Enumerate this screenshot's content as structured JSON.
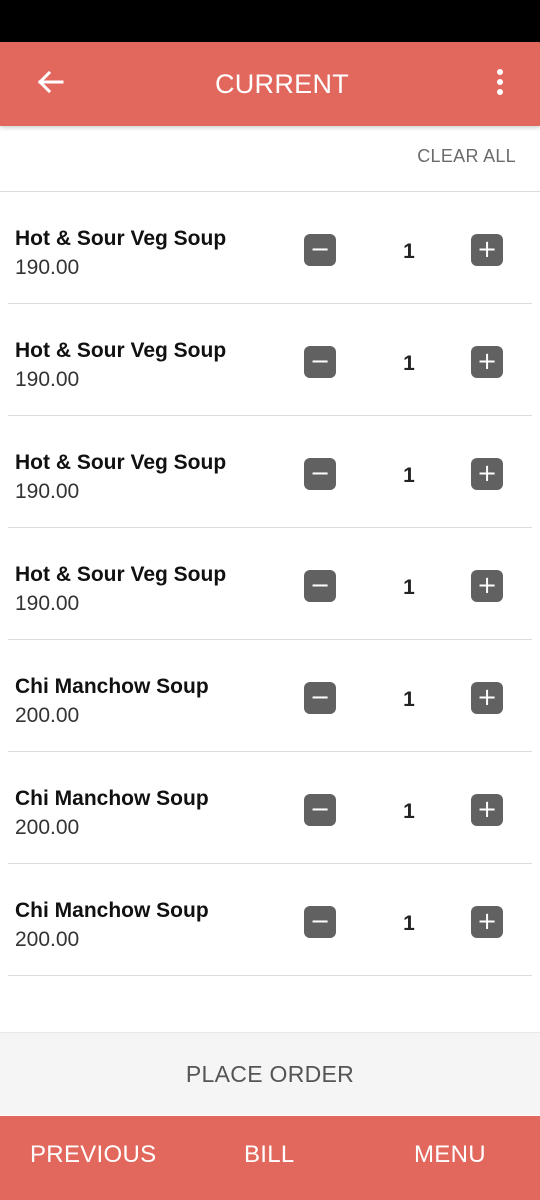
{
  "header": {
    "title": "CURRENT",
    "back_icon": "arrow-left-icon",
    "more_icon": "more-vertical-icon"
  },
  "toolbar": {
    "clear_all_label": "CLEAR ALL"
  },
  "cart": {
    "items": [
      {
        "name": "Hot & Sour Veg Soup",
        "price": "190.00",
        "quantity": "1"
      },
      {
        "name": "Hot & Sour Veg Soup",
        "price": "190.00",
        "quantity": "1"
      },
      {
        "name": "Hot & Sour Veg Soup",
        "price": "190.00",
        "quantity": "1"
      },
      {
        "name": "Hot & Sour Veg Soup",
        "price": "190.00",
        "quantity": "1"
      },
      {
        "name": "Chi Manchow Soup",
        "price": "200.00",
        "quantity": "1"
      },
      {
        "name": "Chi Manchow Soup",
        "price": "200.00",
        "quantity": "1"
      },
      {
        "name": "Chi Manchow Soup",
        "price": "200.00",
        "quantity": "1"
      }
    ],
    "minus_icon": "minus-icon",
    "plus_icon": "plus-icon"
  },
  "actions": {
    "place_order_label": "PLACE ORDER"
  },
  "bottom_nav": {
    "previous_label": "PREVIOUS",
    "bill_label": "BILL",
    "menu_label": "MENU"
  },
  "colors": {
    "accent": "#e2685d",
    "stepper_button": "#616161",
    "status_bar": "#000000"
  }
}
